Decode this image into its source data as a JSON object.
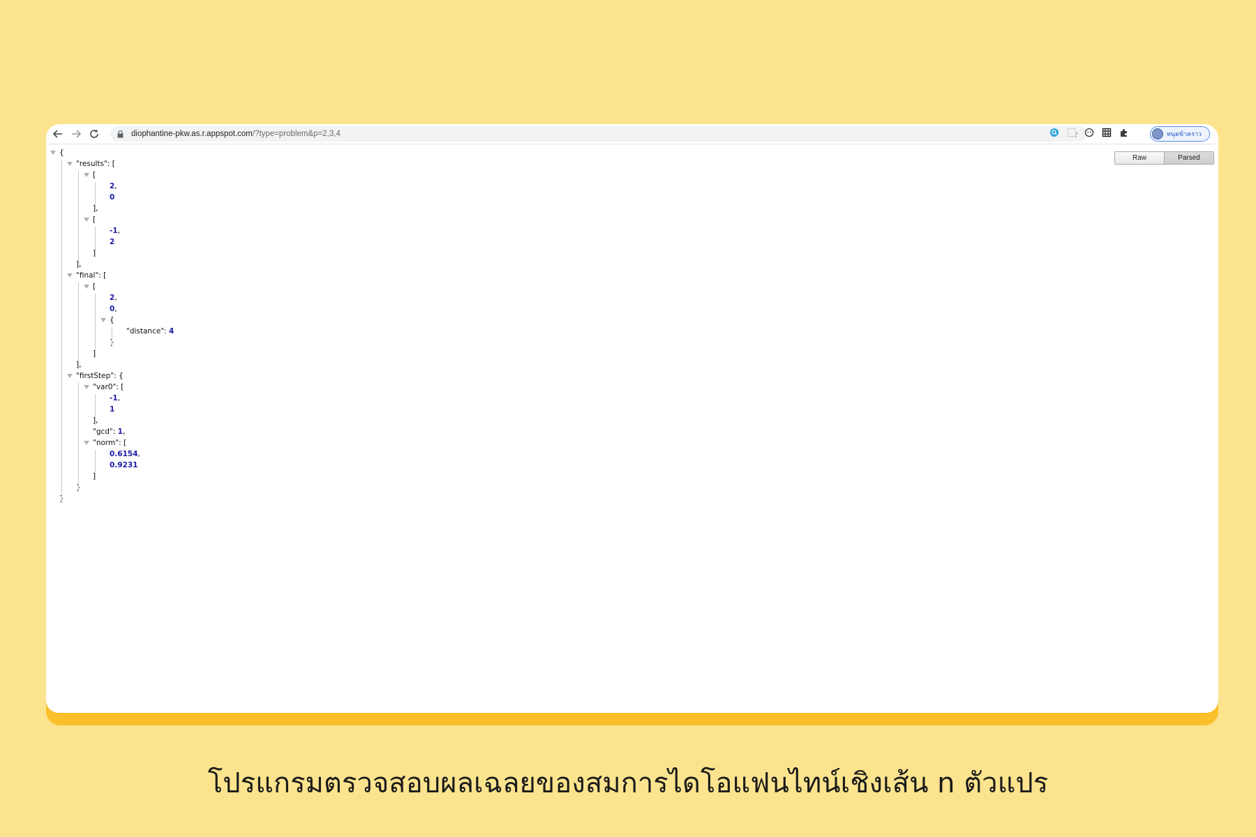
{
  "browser": {
    "url_host": "diophantine-pkw.as.r.appspot.com",
    "url_path": "/?type=problem&p=2,3,4",
    "profile_name": "หนุดข้าคราว",
    "icons": {
      "back": "back-arrow-icon",
      "forward": "forward-arrow-icon",
      "reload": "reload-icon",
      "lock": "lock-icon",
      "star": "bookmark-star-icon",
      "extensions": [
        "search-extension-icon",
        "blank-extension-icon",
        "circle-extension-icon",
        "grid-extension-icon",
        "puzzle-icon"
      ]
    }
  },
  "view_toggle": {
    "raw_label": "Raw",
    "parsed_label": "Parsed",
    "active": "Parsed"
  },
  "json_view": {
    "lines": [
      {
        "indent": 0,
        "text": "{",
        "collapsible": true
      },
      {
        "indent": 1,
        "key": "\"results\"",
        "text": ": [",
        "collapsible": true
      },
      {
        "indent": 2,
        "text": "[",
        "collapsible": true
      },
      {
        "indent": 3,
        "num": "2",
        "suffix": ","
      },
      {
        "indent": 3,
        "num": "0"
      },
      {
        "indent": 2,
        "text": "],"
      },
      {
        "indent": 2,
        "text": "[",
        "collapsible": true
      },
      {
        "indent": 3,
        "num": "-1",
        "suffix": ","
      },
      {
        "indent": 3,
        "num": "2"
      },
      {
        "indent": 2,
        "text": "]"
      },
      {
        "indent": 1,
        "text": "],"
      },
      {
        "indent": 1,
        "key": "\"final\"",
        "text": ": [",
        "collapsible": true
      },
      {
        "indent": 2,
        "text": "[",
        "collapsible": true
      },
      {
        "indent": 3,
        "num": "2",
        "suffix": ","
      },
      {
        "indent": 3,
        "num": "0",
        "suffix": ","
      },
      {
        "indent": 3,
        "text": "{",
        "collapsible": true
      },
      {
        "indent": 4,
        "key": "\"distance\"",
        "text": ": ",
        "num": "4"
      },
      {
        "indent": 3,
        "text": "}"
      },
      {
        "indent": 2,
        "text": "]"
      },
      {
        "indent": 1,
        "text": "],"
      },
      {
        "indent": 1,
        "key": "\"firstStep\"",
        "text": ": {",
        "collapsible": true
      },
      {
        "indent": 2,
        "key": "\"var0\"",
        "text": ": [",
        "collapsible": true
      },
      {
        "indent": 3,
        "num": "-1",
        "suffix": ","
      },
      {
        "indent": 3,
        "num": "1"
      },
      {
        "indent": 2,
        "text": "],"
      },
      {
        "indent": 2,
        "key": "\"gcd\"",
        "text": ": ",
        "num": "1",
        "suffix": ","
      },
      {
        "indent": 2,
        "key": "\"norm\"",
        "text": ": [",
        "collapsible": true
      },
      {
        "indent": 3,
        "num": "0.6154",
        "suffix": ","
      },
      {
        "indent": 3,
        "num": "0.9231"
      },
      {
        "indent": 2,
        "text": "]"
      },
      {
        "indent": 1,
        "text": "}"
      },
      {
        "indent": 0,
        "text": "}"
      }
    ]
  },
  "caption": "โปรแกรมตรวจสอบผลเฉลยของสมการไดโอแฟนไทน์เชิงเส้น n ตัวแปร",
  "colors": {
    "background": "#fce48e",
    "frame_shadow": "#fbbf2a",
    "json_number": "#1a1aa6",
    "profile_border": "#5b8def"
  }
}
